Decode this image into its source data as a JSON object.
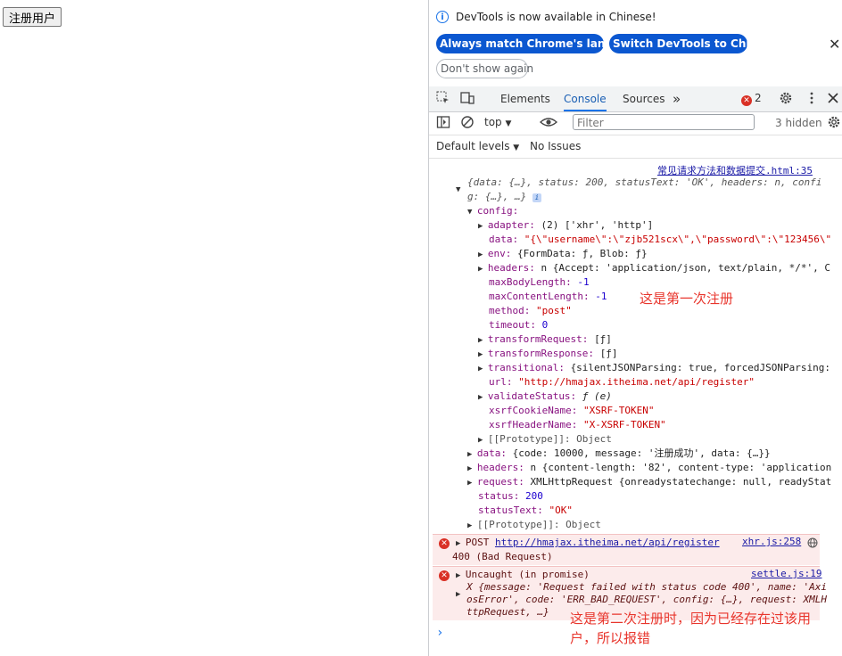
{
  "page": {
    "register_button": "注册用户"
  },
  "devtools": {
    "infobar": {
      "message": "DevTools is now available in Chinese!",
      "btn_match": "Always match Chrome's language",
      "btn_switch": "Switch DevTools to Chinese",
      "btn_dont_show": "Don't show again",
      "close": "✕"
    },
    "tabs": {
      "elements": "Elements",
      "console": "Console",
      "sources": "Sources",
      "more": "»",
      "error_count": "2"
    },
    "toolbar": {
      "context": "top",
      "filter_placeholder": "Filter",
      "hidden": "3 hidden",
      "levels": "Default levels",
      "issues": "No Issues"
    },
    "console": {
      "src1": "常见请求方法和数据提交.html:35",
      "obj_summary_1": "{data: {…}, status: 200, statusText: 'OK', headers: n, confi",
      "obj_summary_2": "g: {…}, …}",
      "config": "config:",
      "adapter_k": "adapter:",
      "adapter_v": "(2) ['xhr', 'http']",
      "data_k": "data:",
      "data_v": "\"{\\\"username\\\":\\\"zjb521scx\\\",\\\"password\\\":\\\"123456\\\"",
      "env_k": "env:",
      "env_v": "{FormData: ƒ, Blob: ƒ}",
      "headers_k": "headers:",
      "headers_v": "n {Accept: 'application/json, text/plain, */*', C",
      "maxbody_k": "maxBodyLength:",
      "maxbody_v": "-1",
      "maxcontent_k": "maxContentLength:",
      "maxcontent_v": "-1",
      "method_k": "method:",
      "method_v": "\"post\"",
      "timeout_k": "timeout:",
      "timeout_v": "0",
      "treq_k": "transformRequest:",
      "treq_v": "[ƒ]",
      "tres_k": "transformResponse:",
      "tres_v": "[ƒ]",
      "trans_k": "transitional:",
      "trans_v": "{silentJSONParsing: true, forcedJSONParsing:",
      "url_k": "url:",
      "url_v": "\"http://hmajax.itheima.net/api/register\"",
      "valid_k": "validateStatus:",
      "valid_v": "ƒ (e)",
      "xsrfc_k": "xsrfCookieName:",
      "xsrfc_v": "\"XSRF-TOKEN\"",
      "xsrfh_k": "xsrfHeaderName:",
      "xsrfh_v": "\"X-XSRF-TOKEN\"",
      "proto1": "[[Prototype]]: Object",
      "data2_k": "data:",
      "data2_v": "{code: 10000, message: '注册成功', data: {…}}",
      "headers2_k": "headers:",
      "headers2_v": "n {content-length: '82', content-type: 'application",
      "request_k": "request:",
      "request_v": "XMLHttpRequest {onreadystatechange: null, readyStat",
      "status_k": "status:",
      "status_v": "200",
      "stext_k": "statusText:",
      "stext_v": "\"OK\"",
      "proto2": "[[Prototype]]: Object",
      "err1_method": "POST",
      "err1_url": "http://hmajax.itheima.net/api/register",
      "err1_src": "xhr.js:258",
      "err1_status": "400 (Bad Request)",
      "err2_title": "Uncaught (in promise)",
      "err2_src": "settle.js:19",
      "err2_l1": "X {message: 'Request failed with status code 400', name: 'Axi",
      "err2_l2": "osError', code: 'ERR_BAD_REQUEST', config: {…}, request: XMLH",
      "err2_l3": "ttpRequest, …}"
    },
    "annotations": {
      "first": "这是第一次注册",
      "second_l1": "这是第二次注册时，因为已经存在过该用",
      "second_l2": "户，所以报错"
    }
  }
}
